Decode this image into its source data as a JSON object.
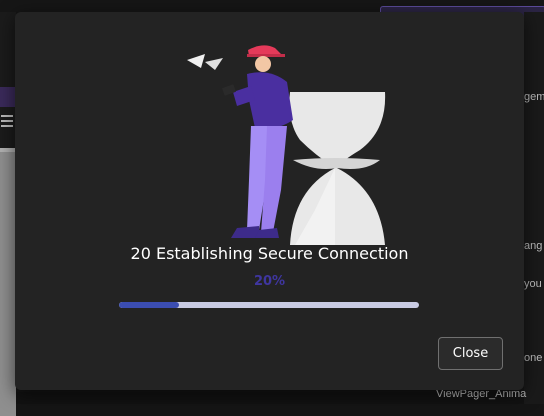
{
  "background": {
    "right_labels": [
      "gem",
      "ang",
      "you",
      "one"
    ],
    "bottom_label": "ViewPager_Anima"
  },
  "dialog": {
    "title": "20 Establishing Secure Connection",
    "progress_percent_text": "20%",
    "progress_fraction": 0.2,
    "close_label": "Close"
  },
  "colors": {
    "accent": "#3b4db1",
    "percent_text": "#3f36a0",
    "modal_bg": "#232323"
  }
}
